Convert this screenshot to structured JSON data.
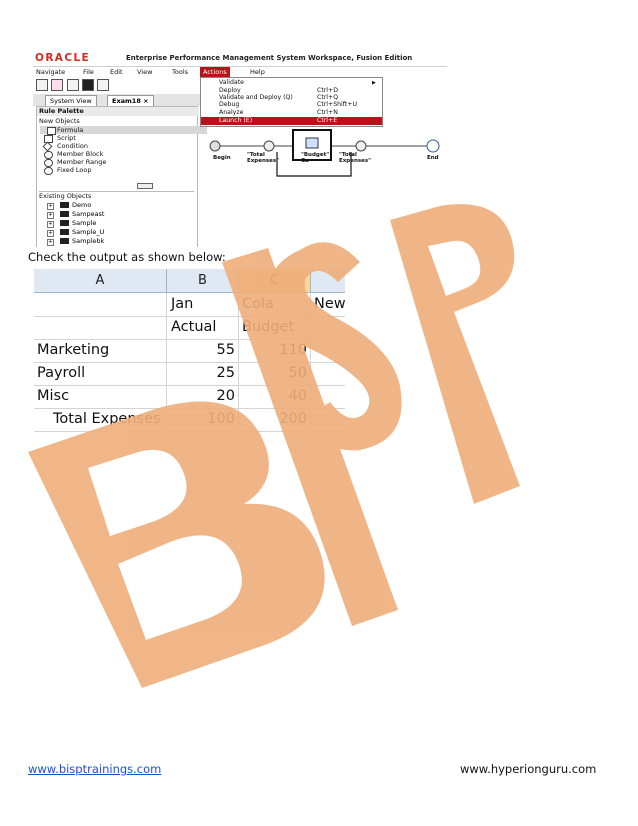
{
  "colors": {
    "oracle_red": "#d22b1f",
    "menu_highlight": "#b6131a",
    "watermark": "#efae7a",
    "excel_header": "#dfe8f3",
    "excel_header_selected": "#f9d79a",
    "link": "#1155cc"
  },
  "watermark": {
    "text": "BISP"
  },
  "oracle_window": {
    "logo": "ORACLE",
    "title": "Enterprise Performance Management System Workspace, Fusion Edition",
    "menu": [
      "Navigate",
      "File",
      "Edit",
      "View",
      "Tools",
      "Actions",
      "Help"
    ],
    "active_menu": "Actions",
    "tabs": [
      "System View",
      "Exam18"
    ],
    "tab_close": "×",
    "rule_palette": {
      "title": "Rule Palette",
      "new_objects_label": "New Objects",
      "new_objects": [
        "Formula",
        "Script",
        "Condition",
        "Member Block",
        "Member Range",
        "Fixed Loop"
      ],
      "existing_objects_label": "Existing Objects",
      "existing_objects": [
        "Demo",
        "Sampeast",
        "Sample",
        "Sample_U",
        "Samplebk"
      ]
    },
    "actions_menu": [
      {
        "label": "Validate",
        "shortcut": "",
        "submenu": true
      },
      {
        "label": "Deploy",
        "shortcut": "Ctrl+D"
      },
      {
        "label": "Validate and Deploy (Q)",
        "shortcut": "Ctrl+Q"
      },
      {
        "label": "Debug",
        "shortcut": "Ctrl+Shift+U"
      },
      {
        "label": "Analyze",
        "shortcut": "Ctrl+N"
      },
      {
        "label": "Launch (E)",
        "shortcut": "Ctrl+E",
        "highlighted": true
      }
    ],
    "flow": {
      "begin": "Begin",
      "node1": "\"Total Expenses\"",
      "node2": "\"Budget\" Ca",
      "node3": "\"Total Expenses\"",
      "end": "End"
    }
  },
  "caption": "Check the output as shown below:",
  "spreadsheet": {
    "columns": [
      "A",
      "B",
      "C"
    ],
    "selected_column": "C",
    "row1": {
      "b": "Jan",
      "c": "Cola",
      "d": "New"
    },
    "row2": {
      "b": "Actual",
      "c": "Budget"
    },
    "rows": [
      {
        "label": "Marketing",
        "actual": "55",
        "budget": "110"
      },
      {
        "label": "Payroll",
        "actual": "25",
        "budget": "50"
      },
      {
        "label": "Misc",
        "actual": "20",
        "budget": "40"
      },
      {
        "label": "Total Expenses",
        "actual": "100",
        "budget": "200"
      }
    ]
  },
  "footer": {
    "left_link": "www.bisptrainings.com",
    "right_text": "www.hyperionguru.com"
  }
}
